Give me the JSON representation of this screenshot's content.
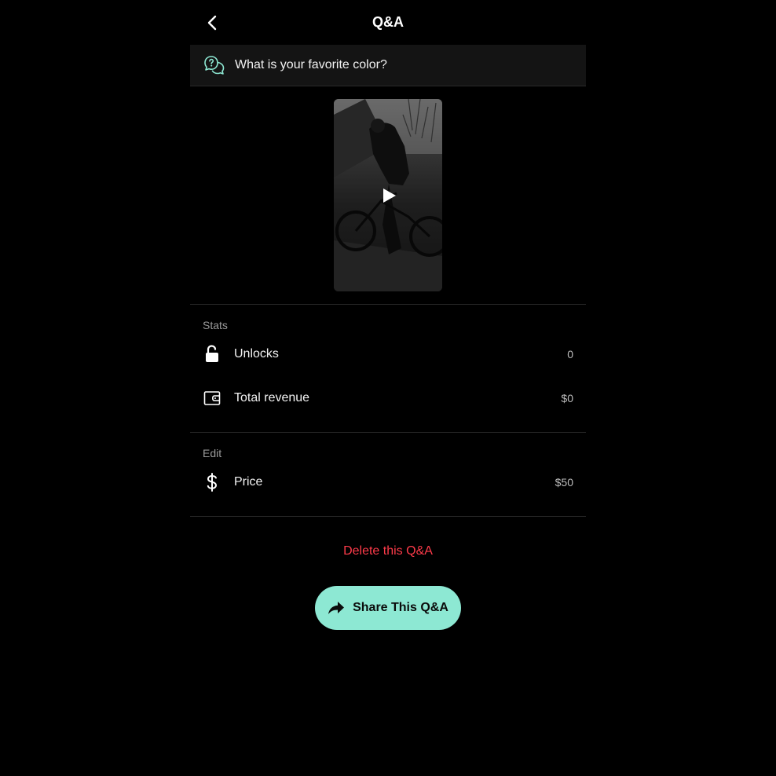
{
  "header": {
    "title": "Q&A",
    "back_icon": "chevron-left-icon"
  },
  "question": {
    "icon": "question-chat-icon",
    "text": "What is your favorite color?",
    "accent": "#8de8d3"
  },
  "video": {
    "play_icon": "play-icon"
  },
  "stats": {
    "label": "Stats",
    "items": [
      {
        "icon": "unlock-icon",
        "label": "Unlocks",
        "value": "0"
      },
      {
        "icon": "wallet-icon",
        "label": "Total revenue",
        "value": "$0"
      }
    ]
  },
  "edit": {
    "label": "Edit",
    "items": [
      {
        "icon": "dollar-icon",
        "label": "Price",
        "value": "$50"
      }
    ]
  },
  "actions": {
    "delete_label": "Delete this Q&A",
    "delete_color": "#ff3b4a",
    "share_label": "Share This Q&A",
    "share_icon": "share-arrow-icon",
    "share_color": "#8de8d3"
  }
}
